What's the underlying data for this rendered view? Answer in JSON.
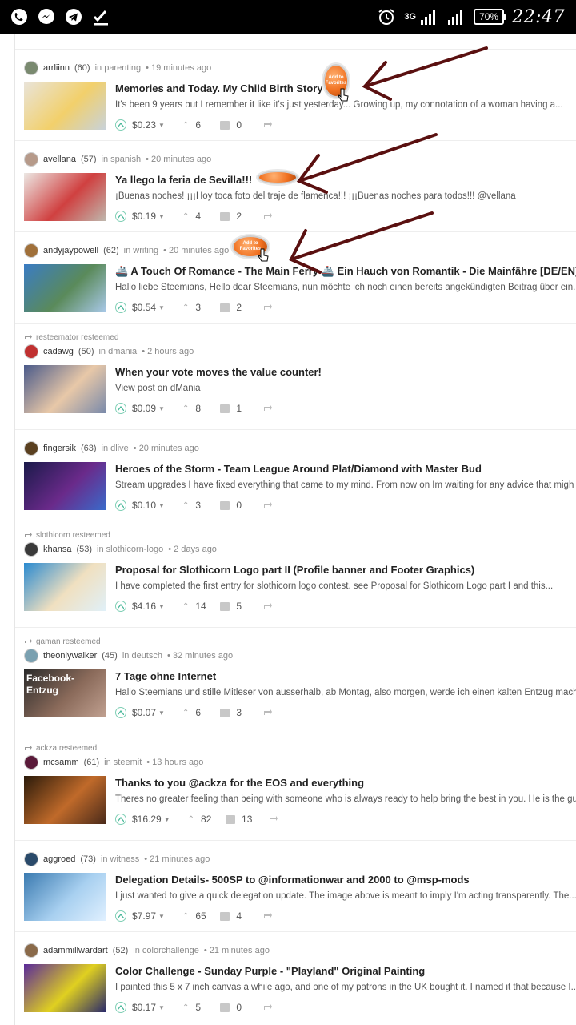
{
  "statusbar": {
    "left_icons": [
      "whatsapp-icon",
      "messenger-icon",
      "telegram-icon",
      "check-icon"
    ],
    "network": "3G",
    "battery": "70%",
    "time": "22:47"
  },
  "favorites_badge": {
    "label": "Add to Favorites"
  },
  "posts": [
    {
      "resteem": "",
      "author": "arrliinn",
      "rep": "(60)",
      "category": "in parenting",
      "time": "• 19 minutes ago",
      "title": "Memories and Today. My Child Birth Story",
      "summary": "It's been 9 years but I remember it like it's just yesterday... Growing up, my connotation of a woman having a...",
      "payout": "$0.23",
      "votes": "6",
      "comments": "0",
      "avatar_color": "#7a8a70",
      "thumb_colors": [
        "#e9e4da",
        "#f2d06b",
        "#c8d2da"
      ]
    },
    {
      "resteem": "",
      "author": "avellana",
      "rep": "(57)",
      "category": "in spanish",
      "time": "• 20 minutes ago",
      "title": "Ya llego la feria de Sevilla!!!",
      "summary": "¡Buenas noches! ¡¡¡Hoy toca foto del traje de flamenca!!! ¡¡¡Buenas noches para todos!!! @vellana",
      "payout": "$0.19",
      "votes": "4",
      "comments": "2",
      "avatar_color": "#b69a8a",
      "thumb_colors": [
        "#ece8e4",
        "#d04040",
        "#bfb7ad"
      ]
    },
    {
      "resteem": "",
      "author": "andyjaypowell",
      "rep": "(62)",
      "category": "in writing",
      "time": "• 20 minutes ago",
      "title": "🚢 A Touch Of Romance - The Main Ferry 🚢 Ein Hauch von Romantik - Die Mainfähre [DE/EN]",
      "summary": "Hallo liebe Steemians, Hello dear Steemians, nun möchte ich noch einen bereits angekündigten Beitrag über ein...",
      "payout": "$0.54",
      "votes": "3",
      "comments": "2",
      "avatar_color": "#a0703a",
      "thumb_colors": [
        "#3a7cc4",
        "#5a8a5a",
        "#a8c8e8"
      ]
    },
    {
      "resteem": "resteemator resteemed",
      "author": "cadawg",
      "rep": "(50)",
      "category": "in dmania",
      "time": "• 2 hours ago",
      "title": "When your vote moves the value counter!",
      "summary": "View post on dMania",
      "payout": "$0.09",
      "votes": "8",
      "comments": "1",
      "avatar_color": "#c03030",
      "thumb_colors": [
        "#4a5a8a",
        "#e8c8a8",
        "#7a8aaa"
      ]
    },
    {
      "resteem": "",
      "author": "fingersik",
      "rep": "(63)",
      "category": "in dlive",
      "time": "• 20 minutes ago",
      "title": "Heroes of the Storm - Team League Around Plat/Diamond with Master Bud",
      "summary": "Stream upgrades I have fixed everything that came to my mind. From now on Im waiting for any advice that migh",
      "payout": "$0.10",
      "votes": "3",
      "comments": "0",
      "avatar_color": "#5a4020",
      "thumb_colors": [
        "#1a1a4a",
        "#6a2a8a",
        "#3a6aca"
      ]
    },
    {
      "resteem": "slothicorn resteemed",
      "author": "khansa",
      "rep": "(53)",
      "category": "in slothicorn-logo",
      "time": "• 2 days ago",
      "title": "Proposal for Slothicorn Logo part II (Profile banner and Footer Graphics)",
      "summary": "I have completed the first entry for slothicorn logo contest. see Proposal for Slothicorn Logo part I and this...",
      "payout": "$4.16",
      "votes": "14",
      "comments": "5",
      "avatar_color": "#3a3a3a",
      "thumb_colors": [
        "#2a8ad0",
        "#f0e0c0",
        "#e0f0f8"
      ]
    },
    {
      "resteem": "gaman resteemed",
      "author": "theonlywalker",
      "rep": "(45)",
      "category": "in deutsch",
      "time": "• 32 minutes ago",
      "title": "7 Tage ohne Internet",
      "summary": "Hallo Steemians und stille Mitleser von ausserhalb, ab Montag, also morgen, werde ich einen kalten Entzug mach",
      "payout": "$0.07",
      "votes": "6",
      "comments": "3",
      "avatar_color": "#7aa0b0",
      "thumb_colors": [
        "#2a2a2a",
        "#8a6a5a",
        "#c0a090"
      ],
      "thumb_text": "Facebook-Entzug"
    },
    {
      "resteem": "ackza resteemed",
      "author": "mcsamm",
      "rep": "(61)",
      "category": "in steemit",
      "time": "• 13 hours ago",
      "title": "Thanks to you @ackza for the EOS and everything",
      "summary": "Theres no greater feeling than being with someone who is always ready to help bring the best in you. He is the gu",
      "payout": "$16.29",
      "votes": "82",
      "comments": "13",
      "avatar_color": "#5a1a3a",
      "thumb_colors": [
        "#2a1a0a",
        "#c06a2a",
        "#4a2a1a"
      ]
    },
    {
      "resteem": "",
      "author": "aggroed",
      "rep": "(73)",
      "category": "in witness",
      "time": "• 21 minutes ago",
      "title": "Delegation Details- 500SP to @informationwar and 2000 to @msp-mods",
      "summary": "I just wanted to give a quick delegation update. The image above is meant to imply I'm acting transparently. The...",
      "payout": "$7.97",
      "votes": "65",
      "comments": "4",
      "avatar_color": "#2a4a6a",
      "thumb_colors": [
        "#3a7ab0",
        "#a8d0f0",
        "#e0f0ff"
      ]
    },
    {
      "resteem": "",
      "author": "adammillwardart",
      "rep": "(52)",
      "category": "in colorchallenge",
      "time": "• 21 minutes ago",
      "title": "Color Challenge - Sunday Purple - \"Playland\" Original Painting",
      "summary": "I painted this 5 x 7 inch canvas a while ago, and one of my patrons in the UK bought it. I named it that because I...",
      "payout": "$0.17",
      "votes": "5",
      "comments": "0",
      "avatar_color": "#8a6a4a",
      "thumb_colors": [
        "#5a2a9a",
        "#e0d020",
        "#2a2a6a"
      ]
    }
  ]
}
